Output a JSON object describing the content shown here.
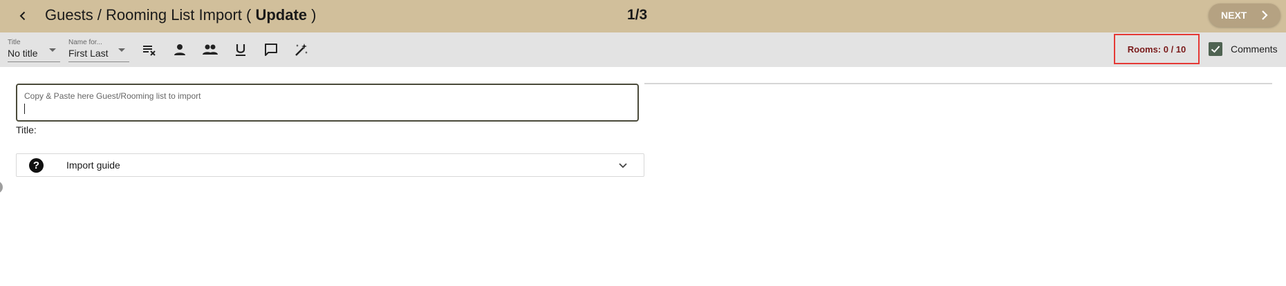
{
  "header": {
    "title_main": "Guests / Rooming List Import (",
    "title_bold": "Update",
    "title_end": ")",
    "step": "1/3",
    "next_label": "NEXT"
  },
  "toolbar": {
    "title_select": {
      "label": "Title",
      "value": "No title"
    },
    "name_select": {
      "label": "Name for...",
      "value": "First Last"
    },
    "icons": [
      "clear-format-icon",
      "person-icon",
      "people-icon",
      "underline-icon",
      "comment-icon",
      "magic-wand-icon"
    ],
    "rooms_counter": "Rooms: 0 / 10",
    "comments_checked": true,
    "comments_label": "Comments"
  },
  "main": {
    "import_placeholder": "Copy & Paste here Guest/Rooming list to import",
    "title_label": "Title:",
    "guide_label": "Import guide"
  },
  "colors": {
    "header_bg": "#d1bf9b",
    "toolbar_bg": "#e3e3e3",
    "accent_dark_green": "#4f6352",
    "rooms_text": "#7a1a1a",
    "highlight_border": "#e53935"
  }
}
